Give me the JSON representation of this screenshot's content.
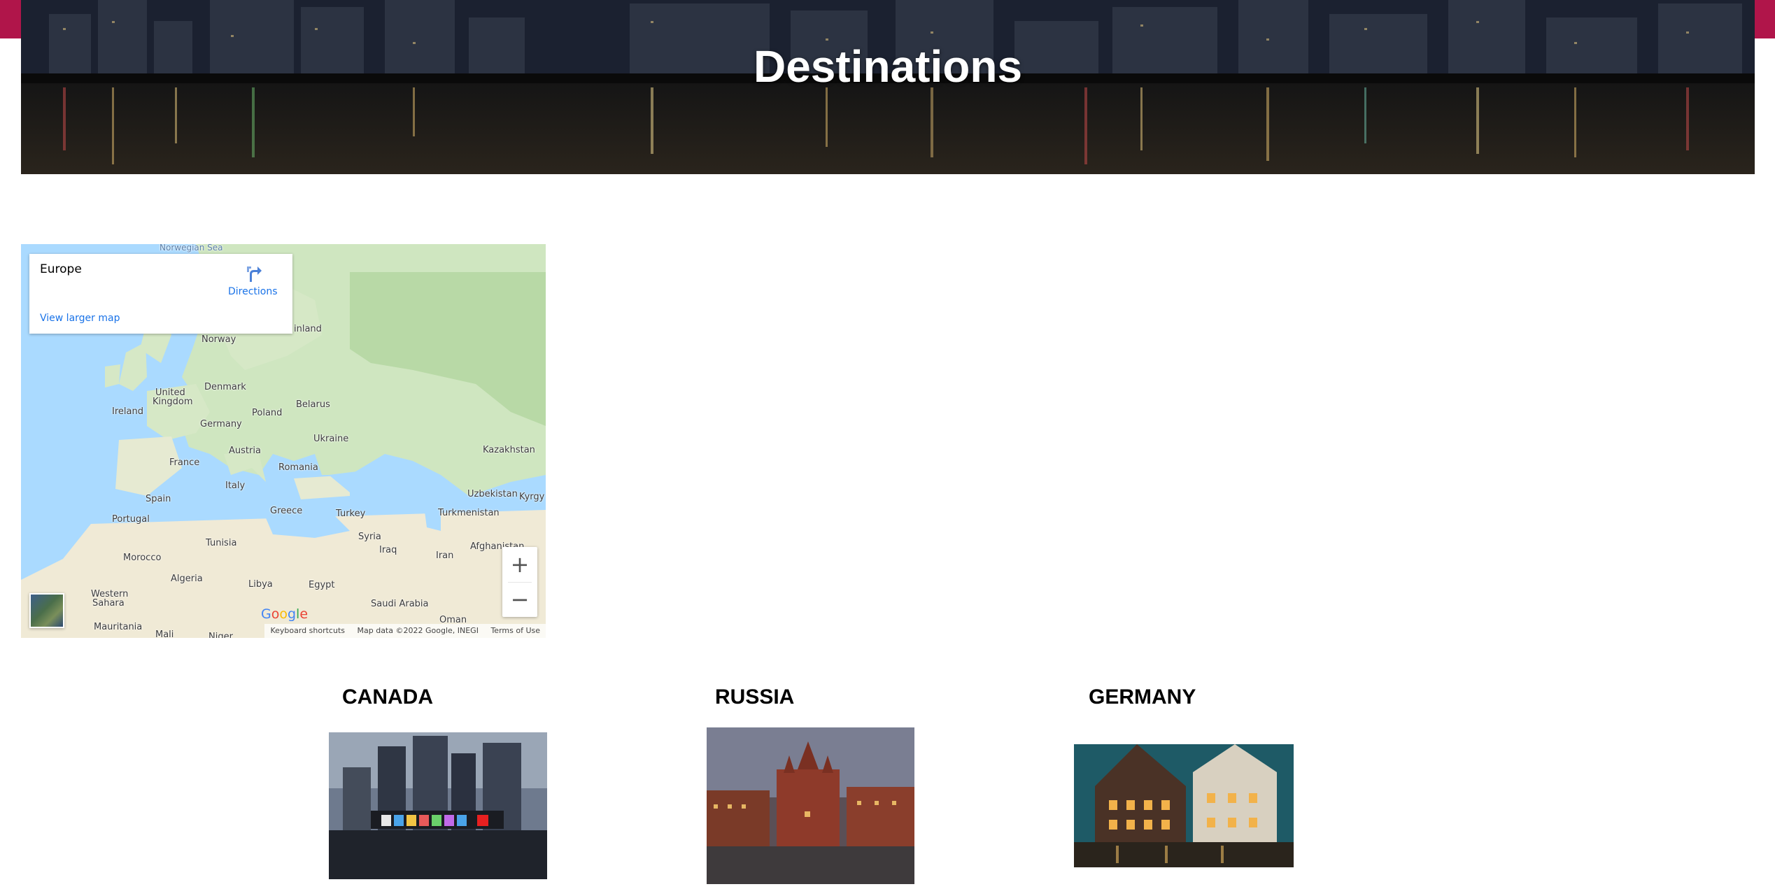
{
  "header": {
    "title": "Destinations",
    "accent_color": "#b0154a"
  },
  "map": {
    "info_card": {
      "place_name": "Europe",
      "directions_label": "Directions",
      "larger_map_link": "View larger map"
    },
    "labels": {
      "norwegian_sea": "Norwegian Sea",
      "finland": "inland",
      "norway": "Norway",
      "denmark": "Denmark",
      "united_kingdom_1": "United",
      "united_kingdom_2": "Kingdom",
      "belarus": "Belarus",
      "ireland": "Ireland",
      "poland": "Poland",
      "germany": "Germany",
      "ukraine": "Ukraine",
      "austria": "Austria",
      "kazakhstan": "Kazakhstan",
      "france": "France",
      "romania": "Romania",
      "italy": "Italy",
      "uzbekistan": "Uzbekistan",
      "kyrgyz": "Kyrgy",
      "spain": "Spain",
      "greece": "Greece",
      "turkey": "Turkey",
      "turkmenistan": "Turkmenistan",
      "portugal": "Portugal",
      "syria": "Syria",
      "tunisia": "Tunisia",
      "afghanistan": "Afghanistan",
      "iraq": "Iraq",
      "morocco": "Morocco",
      "iran": "Iran",
      "algeria": "Algeria",
      "libya": "Libya",
      "egypt": "Egypt",
      "western_sahara_1": "Western",
      "western_sahara_2": "Sahara",
      "saudi_arabia": "Saudi Arabia",
      "oman": "Oman",
      "mauritania": "Mauritania",
      "mali": "Mali",
      "niger": "Niger"
    },
    "zoom_in": "+",
    "zoom_out": "−",
    "footer": {
      "shortcuts": "Keyboard shortcuts",
      "map_data": "Map data ©2022 Google, INEGI",
      "terms": "Terms of Use"
    },
    "google_logo": {
      "g1": "G",
      "o1": "o",
      "o2": "o",
      "g2": "g",
      "l": "l",
      "e": "e"
    }
  },
  "destinations": [
    {
      "name": "CANADA"
    },
    {
      "name": "RUSSIA"
    },
    {
      "name": "GERMANY"
    }
  ]
}
